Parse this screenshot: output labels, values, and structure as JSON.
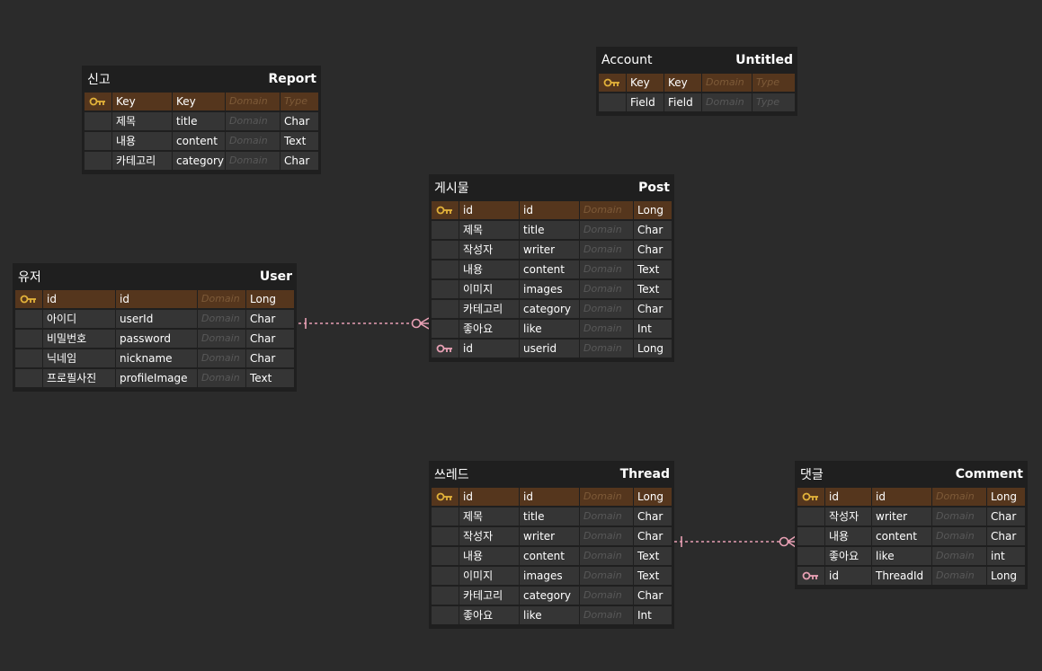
{
  "colors": {
    "background": "#2b2b2b",
    "table_bg": "#1f1f1f",
    "row_bg": "#353535",
    "pk_row_bg": "#55361d",
    "pk_key_icon": "#e2b23a",
    "fk_key_icon": "#e8a0b4",
    "relationship_line": "#e8a0b4"
  },
  "tables": [
    {
      "id": "report",
      "logical": "신고",
      "physical": "Report",
      "columns": [
        {
          "key": "pk",
          "logical": "Key",
          "physical": "Key",
          "domain": "Domain",
          "type": "Type",
          "type_placeholder": true
        },
        {
          "key": "",
          "logical": "제목",
          "physical": "title",
          "domain": "Domain",
          "type": "Char"
        },
        {
          "key": "",
          "logical": "내용",
          "physical": "content",
          "domain": "Domain",
          "type": "Text"
        },
        {
          "key": "",
          "logical": "카테고리",
          "physical": "category",
          "domain": "Domain",
          "type": "Char"
        }
      ]
    },
    {
      "id": "account",
      "logical": "Account",
      "physical": "Untitled",
      "columns": [
        {
          "key": "pk",
          "logical": "Key",
          "physical": "Key",
          "domain": "Domain",
          "type": "Type",
          "type_placeholder": true
        },
        {
          "key": "",
          "logical": "Field",
          "physical": "Field",
          "domain": "Domain",
          "type": "Type",
          "type_placeholder": true
        }
      ]
    },
    {
      "id": "post",
      "logical": "게시물",
      "physical": "Post",
      "columns": [
        {
          "key": "pk",
          "logical": "id",
          "physical": "id",
          "domain": "Domain",
          "type": "Long"
        },
        {
          "key": "",
          "logical": "제목",
          "physical": "title",
          "domain": "Domain",
          "type": "Char"
        },
        {
          "key": "",
          "logical": "작성자",
          "physical": "writer",
          "domain": "Domain",
          "type": "Char"
        },
        {
          "key": "",
          "logical": "내용",
          "physical": "content",
          "domain": "Domain",
          "type": "Text"
        },
        {
          "key": "",
          "logical": "이미지",
          "physical": "images",
          "domain": "Domain",
          "type": "Text"
        },
        {
          "key": "",
          "logical": "카테고리",
          "physical": "category",
          "domain": "Domain",
          "type": "Char"
        },
        {
          "key": "",
          "logical": "좋아요",
          "physical": "like",
          "domain": "Domain",
          "type": "Int"
        },
        {
          "key": "fk",
          "logical": "id",
          "physical": "userid",
          "domain": "Domain",
          "type": "Long"
        }
      ]
    },
    {
      "id": "user",
      "logical": "유저",
      "physical": "User",
      "columns": [
        {
          "key": "pk",
          "logical": "id",
          "physical": "id",
          "domain": "Domain",
          "type": "Long"
        },
        {
          "key": "",
          "logical": "아이디",
          "physical": "userId",
          "domain": "Domain",
          "type": "Char"
        },
        {
          "key": "",
          "logical": "비밀번호",
          "physical": "password",
          "domain": "Domain",
          "type": "Char"
        },
        {
          "key": "",
          "logical": "닉네임",
          "physical": "nickname",
          "domain": "Domain",
          "type": "Char"
        },
        {
          "key": "",
          "logical": "프로필사진",
          "physical": "profileImage",
          "domain": "Domain",
          "type": "Text"
        }
      ]
    },
    {
      "id": "thread",
      "logical": "쓰레드",
      "physical": "Thread",
      "columns": [
        {
          "key": "pk",
          "logical": "id",
          "physical": "id",
          "domain": "Domain",
          "type": "Long"
        },
        {
          "key": "",
          "logical": "제목",
          "physical": "title",
          "domain": "Domain",
          "type": "Char"
        },
        {
          "key": "",
          "logical": "작성자",
          "physical": "writer",
          "domain": "Domain",
          "type": "Char"
        },
        {
          "key": "",
          "logical": "내용",
          "physical": "content",
          "domain": "Domain",
          "type": "Text"
        },
        {
          "key": "",
          "logical": "이미지",
          "physical": "images",
          "domain": "Domain",
          "type": "Text"
        },
        {
          "key": "",
          "logical": "카테고리",
          "physical": "category",
          "domain": "Domain",
          "type": "Char"
        },
        {
          "key": "",
          "logical": "좋아요",
          "physical": "like",
          "domain": "Domain",
          "type": "Int"
        }
      ]
    },
    {
      "id": "comment",
      "logical": "댓글",
      "physical": "Comment",
      "columns": [
        {
          "key": "pk",
          "logical": "id",
          "physical": "id",
          "domain": "Domain",
          "type": "Long"
        },
        {
          "key": "",
          "logical": "작성자",
          "physical": "writer",
          "domain": "Domain",
          "type": "Char"
        },
        {
          "key": "",
          "logical": "내용",
          "physical": "content",
          "domain": "Domain",
          "type": "Char"
        },
        {
          "key": "",
          "logical": "좋아요",
          "physical": "like",
          "domain": "Domain",
          "type": "int"
        },
        {
          "key": "fk",
          "logical": "id",
          "physical": "ThreadId",
          "domain": "Domain",
          "type": "Long"
        }
      ]
    }
  ],
  "relationships": [
    {
      "from": "user",
      "to": "post",
      "kind": "one-to-zero-or-many",
      "style": "dashed"
    },
    {
      "from": "thread",
      "to": "comment",
      "kind": "one-to-zero-or-many",
      "style": "dashed"
    }
  ]
}
